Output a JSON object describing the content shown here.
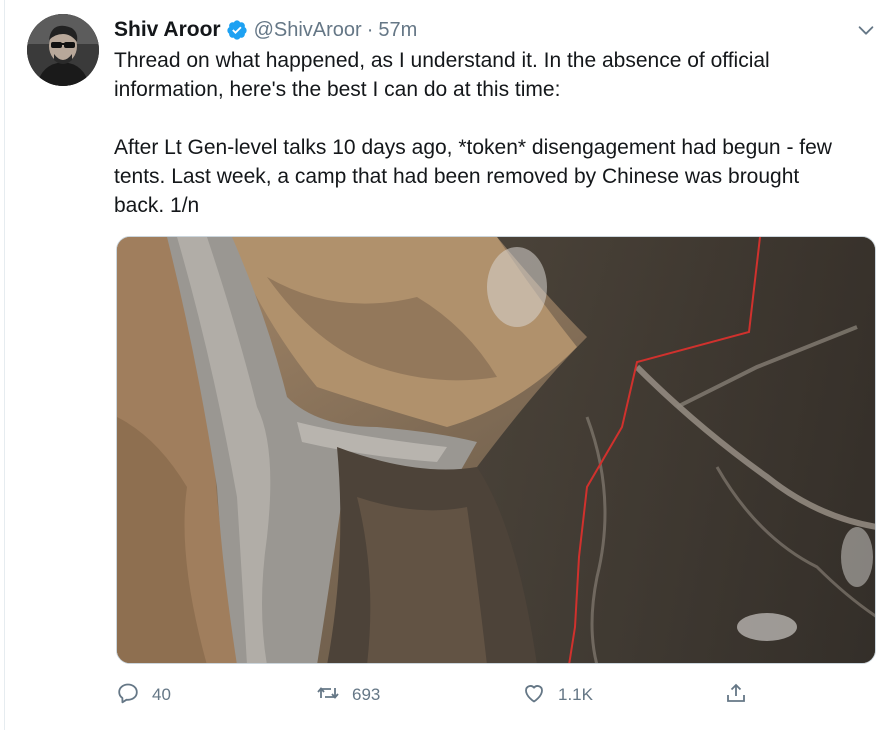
{
  "tweet": {
    "author_name": "Shiv Aroor",
    "handle": "@ShivAroor",
    "separator": "·",
    "time": "57m",
    "paragraphs": [
      "Thread on what happened, as I understand it. In the absence of official information, here's the best I can do at this time:",
      "After Lt Gen-level talks 10 days ago, *token* disengagement had begun - few tents. Last week, a camp that had been removed by Chinese was brought back. 1/n"
    ]
  },
  "actions": {
    "replies": "40",
    "retweets": "693",
    "likes": "1.1K"
  },
  "colors": {
    "verified": "#1da1f2",
    "muted": "#657786",
    "border_line": "#d0312d"
  },
  "icons": [
    "verified-badge-icon",
    "chevron-down-icon",
    "reply-icon",
    "retweet-icon",
    "like-icon",
    "share-icon"
  ]
}
